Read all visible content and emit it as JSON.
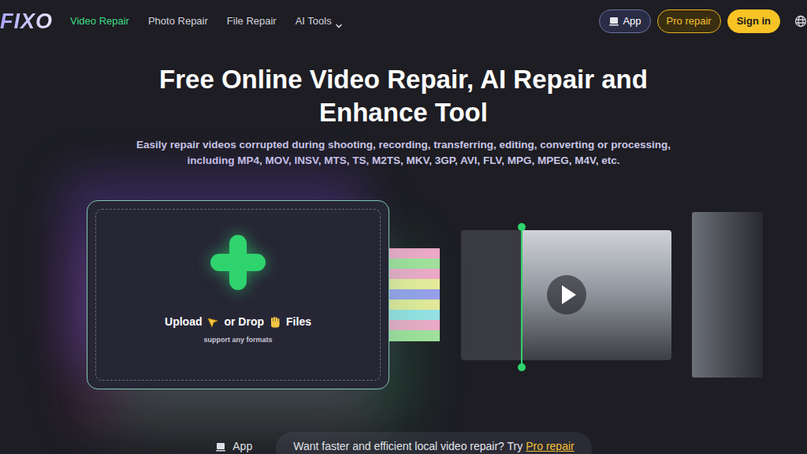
{
  "header": {
    "logo": "FIXO",
    "nav": [
      {
        "label": "Video Repair",
        "selected": true,
        "kind": "link"
      },
      {
        "label": "Photo Repair",
        "selected": false,
        "kind": "link"
      },
      {
        "label": "File Repair",
        "selected": false,
        "kind": "link"
      },
      {
        "label": "AI Tools",
        "selected": false,
        "kind": "dropdown"
      }
    ],
    "actions": [
      {
        "label": "App",
        "kind": "app"
      },
      {
        "label": "Pro repair",
        "kind": "pro"
      },
      {
        "label": "Sign in",
        "kind": "signin"
      }
    ]
  },
  "hero": {
    "title": "Free Online Video Repair, AI Repair and Enhance Tool",
    "subtitle": "Easily repair videos corrupted during shooting, recording, transferring, editing, converting or processing, including MP4, MOV, INSV, MTS, TS, M2TS, MKV, 3GP, AVI, FLV, MPG, MPEG, M4V, etc."
  },
  "upload": {
    "upload": "Upload",
    "drop": "or Drop",
    "files": "Files",
    "hint": "support any formats"
  },
  "preview": {
    "compare_level": 0.29
  },
  "bottom_bar": {
    "app": "App",
    "promo": "Want faster and efficient local video repair? Try",
    "link": "Pro repair"
  }
}
